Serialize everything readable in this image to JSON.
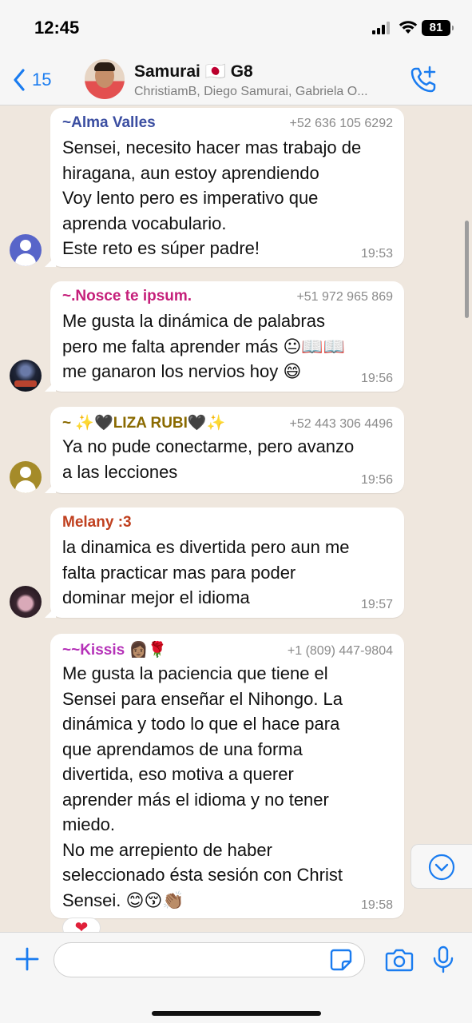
{
  "status_bar": {
    "time": "12:45",
    "battery": "81"
  },
  "header": {
    "back_count": "15",
    "title": "Samurai 🇯🇵 G8",
    "subtitle": "ChristiamB, Diego Samurai, Gabriela O..."
  },
  "messages": [
    {
      "sender": "~Alma Valles",
      "sender_color": "#3b4ea1",
      "phone": "+52 636 105 6292",
      "text": "Sensei, necesito hacer mas trabajo de\nhiragana, aun estoy aprendiendo\nVoy lento pero es imperativo que\naprenda vocabulario.\nEste reto es súper padre!",
      "time": "19:53",
      "avatar": "default-avatar-blue"
    },
    {
      "sender": "~.Nosce te ipsum.",
      "sender_color": "#c51f7a",
      "phone": "+51 972 965 869",
      "text": "Me gusta la dinámica de palabras\npero me falta aprender más 😐📖📖\nme ganaron los nervios hoy 😄",
      "time": "19:56",
      "avatar": "photo-avatar-night"
    },
    {
      "sender": "~ ✨🖤LIZA RUBI🖤✨",
      "sender_color": "#8a6a00",
      "phone": "+52 443 306 4496",
      "text": "Ya no pude conectarme, pero avanzo\na las lecciones",
      "time": "19:56",
      "avatar": "default-avatar-gold"
    },
    {
      "sender": "Melany :3",
      "sender_color": "#c0401f",
      "phone": "",
      "text": "la dinamica es divertida pero aun me\nfalta practicar mas para poder\ndominar mejor el idioma",
      "time": "19:57",
      "avatar": "photo-avatar-girl"
    },
    {
      "sender": "~~Kissis 👩🏽🌹",
      "sender_color": "#b531b8",
      "phone": "+1 (809) 447-9804",
      "text": "Me gusta la paciencia que tiene el\nSensei para enseñar el Nihongo. La\ndinámica y todo lo que el hace para\nque aprendamos de una forma\ndivertida, eso motiva a querer\naprender más el idioma y no tener\nmiedo.\nNo me arrepiento de haber\nseleccionado ésta sesión con Christ\nSensei. 😊😚👏🏽",
      "time": "19:58",
      "reaction": "❤"
    }
  ],
  "composer": {
    "value": "",
    "placeholder": ""
  },
  "colors": {
    "accent": "#1a7cf0",
    "chat_bg": "#efe7de"
  }
}
